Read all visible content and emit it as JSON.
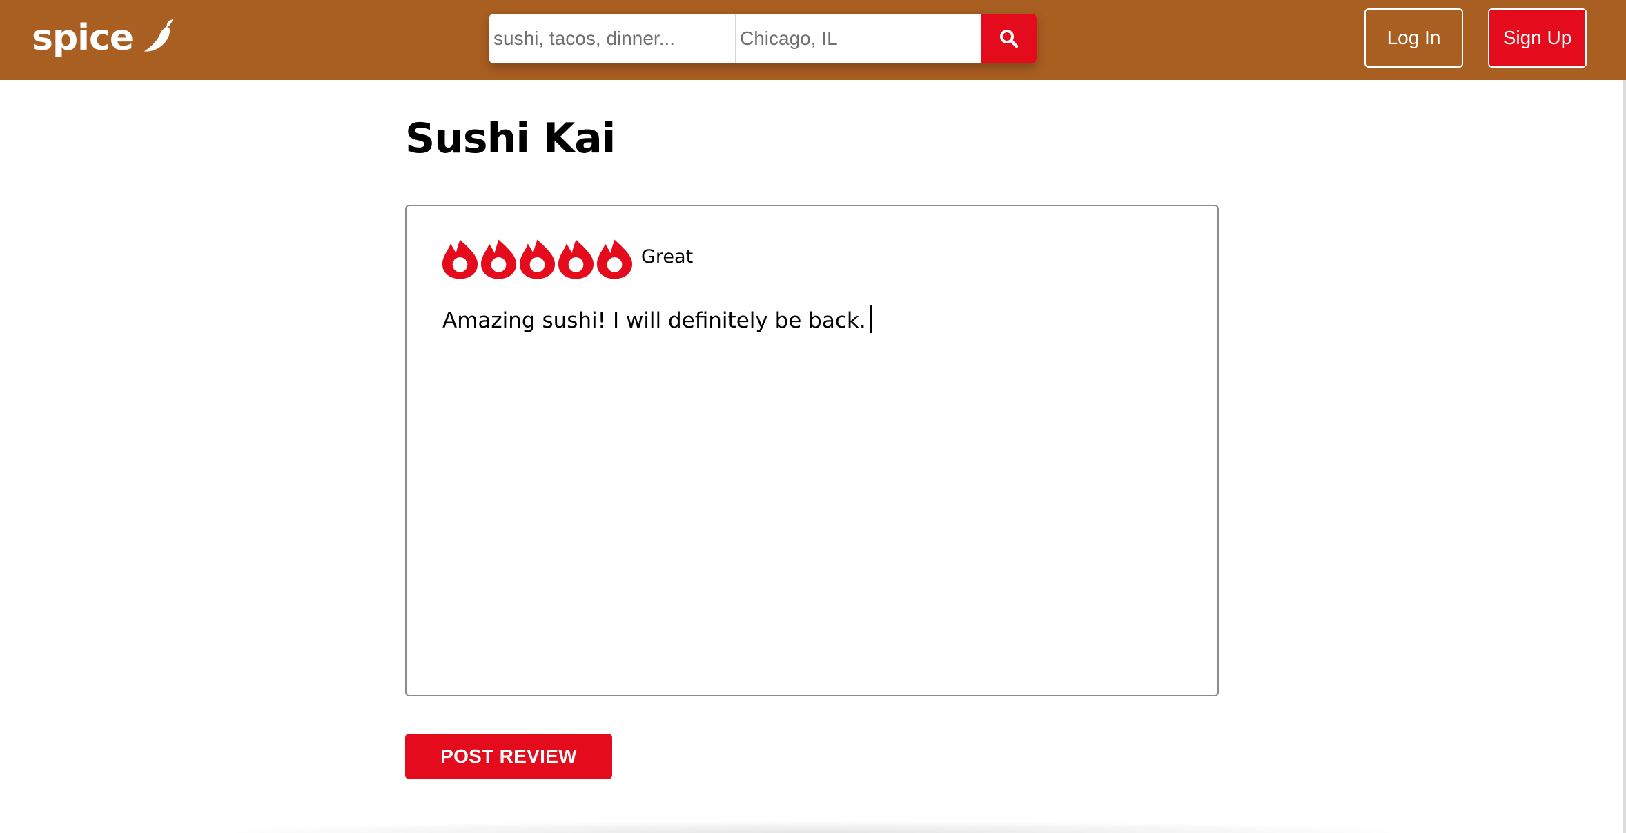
{
  "app": {
    "logo_text": "spice"
  },
  "header": {
    "search_what_placeholder": "sushi, tacos, dinner...",
    "search_where_value": "Chicago, IL",
    "login_label": "Log In",
    "signup_label": "Sign Up"
  },
  "page": {
    "title": "Sushi Kai"
  },
  "review": {
    "rating": 5,
    "max_rating": 5,
    "rating_label": "Great",
    "text": "Amazing sushi! I will definitely be back.",
    "post_label": "POST REVIEW"
  },
  "icons": {
    "logo": "chili-pepper-icon",
    "search": "magnifier-icon",
    "rating": "flame-icon"
  },
  "colors": {
    "header_bg": "#a95e22",
    "accent_red": "#e30b1c"
  }
}
